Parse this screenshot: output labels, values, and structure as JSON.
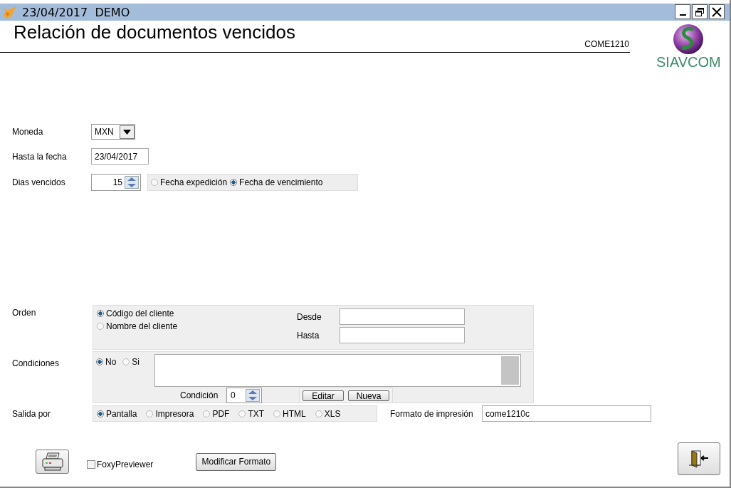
{
  "window": {
    "title": "23/04/2017  DEMO"
  },
  "header": {
    "title": "Relación de documentos vencidos",
    "code": "COME1210"
  },
  "logo": {
    "text": "SIAVCOM"
  },
  "moneda": {
    "label": "Moneda",
    "value": "MXN"
  },
  "hasta_fecha": {
    "label": "Hasta la fecha",
    "value": "23/04/2017"
  },
  "dias_vencidos": {
    "label": "Dias vencidos",
    "value": "15",
    "options": [
      {
        "label": "Fecha expedición",
        "selected": false
      },
      {
        "label": "Fecha de vencimiento",
        "selected": true
      }
    ]
  },
  "orden": {
    "label": "Orden",
    "options": [
      {
        "label": "Código del cliente",
        "selected": true
      },
      {
        "label": "Nombre del cliente",
        "selected": false
      }
    ],
    "desde_label": "Desde",
    "hasta_label": "Hasta"
  },
  "condiciones": {
    "label": "Condiciones",
    "options": [
      {
        "label": "No",
        "selected": true
      },
      {
        "label": "Si",
        "selected": false
      }
    ],
    "condicion_label": "Condición",
    "condicion_value": "0",
    "buttons": [
      "Editar",
      "Nueva"
    ]
  },
  "salida": {
    "label": "Salida por",
    "options": [
      {
        "label": "Pantalla",
        "selected": true
      },
      {
        "label": "Impresora",
        "selected": false
      },
      {
        "label": "PDF",
        "selected": false
      },
      {
        "label": "TXT",
        "selected": false
      },
      {
        "label": "HTML",
        "selected": false
      },
      {
        "label": "XLS",
        "selected": false
      }
    ],
    "formato_label": "Formato de impresión",
    "formato_value": "come1210c"
  },
  "footer": {
    "previewer": {
      "label": "FoxyPreviewer",
      "checked": false
    },
    "modify_button": "Modificar Formato"
  }
}
